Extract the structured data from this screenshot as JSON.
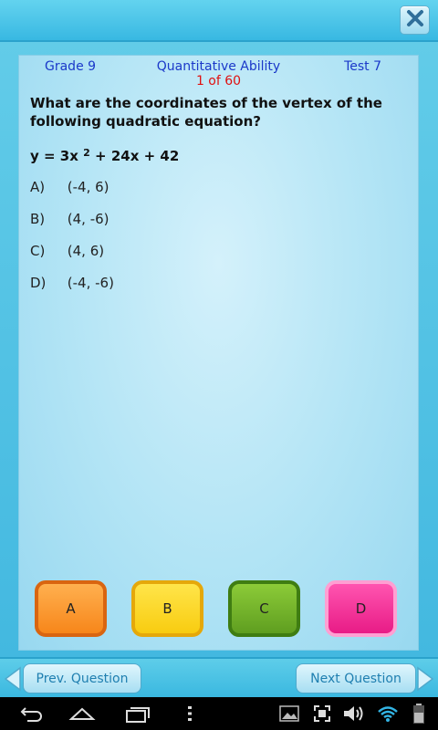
{
  "header": {
    "grade": "Grade 9",
    "subject": "Quantitative Ability",
    "test": "Test 7",
    "counter": "1 of 60"
  },
  "question": {
    "text": "What are the coordinates of the vertex of the following quadratic equation?",
    "equation_prefix": "y = 3x",
    "equation_exp": "2",
    "equation_suffix": " + 24x + 42"
  },
  "choices": [
    {
      "letter": "A)",
      "text": "(-4, 6)"
    },
    {
      "letter": "B)",
      "text": "(4, -6)"
    },
    {
      "letter": "C)",
      "text": "(4, 6)"
    },
    {
      "letter": "D)",
      "text": "(-4, -6)"
    }
  ],
  "answers": [
    "A",
    "B",
    "C",
    "D"
  ],
  "nav": {
    "prev_label": "Prev. Question",
    "next_label": "Next Question"
  },
  "colors": {
    "accent": "#3ab8e0",
    "answer_a": "#f7861a",
    "answer_b": "#f8cc10",
    "answer_c": "#5f9e20",
    "answer_d": "#e81b86",
    "header_text": "#1b39c9",
    "counter_text": "#e01010"
  },
  "icons": {
    "close": "close-icon",
    "system": [
      "back-icon",
      "home-icon",
      "recent-apps-icon",
      "menu-dots-icon",
      "gallery-icon",
      "screenshot-icon",
      "volume-icon",
      "wifi-icon",
      "battery-icon"
    ]
  }
}
